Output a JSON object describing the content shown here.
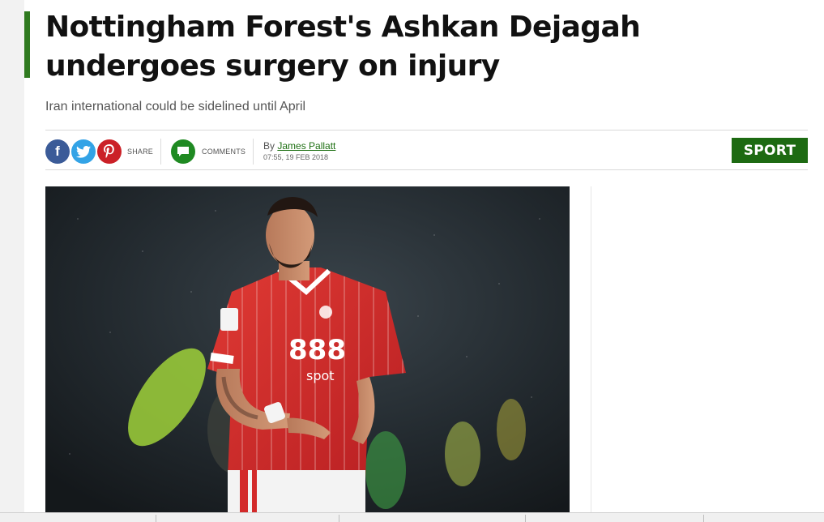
{
  "article": {
    "headline": "Nottingham Forest's Ashkan Dejagah undergoes surgery on injury",
    "standfirst": "Iran international could be sidelined until April",
    "author_prefix": "By",
    "author": "James Pallatt",
    "timestamp": "07:55, 19 FEB 2018",
    "section": "SPORT",
    "image_alt": "Ashkan Dejagah in a red Nottingham Forest kit during a match"
  },
  "share": {
    "share_label": "SHARE",
    "comments_label": "COMMENTS",
    "facebook_glyph": "f",
    "icons": [
      "facebook-icon",
      "twitter-icon",
      "pinterest-icon",
      "comment-icon"
    ]
  },
  "colors": {
    "accent_green": "#2f7a1f",
    "section_badge": "#1d6a12",
    "facebook": "#3b5b98",
    "twitter": "#33a3e6",
    "pinterest": "#cb2027",
    "comments": "#1f8a22",
    "kit_red": "#d32a2a"
  }
}
